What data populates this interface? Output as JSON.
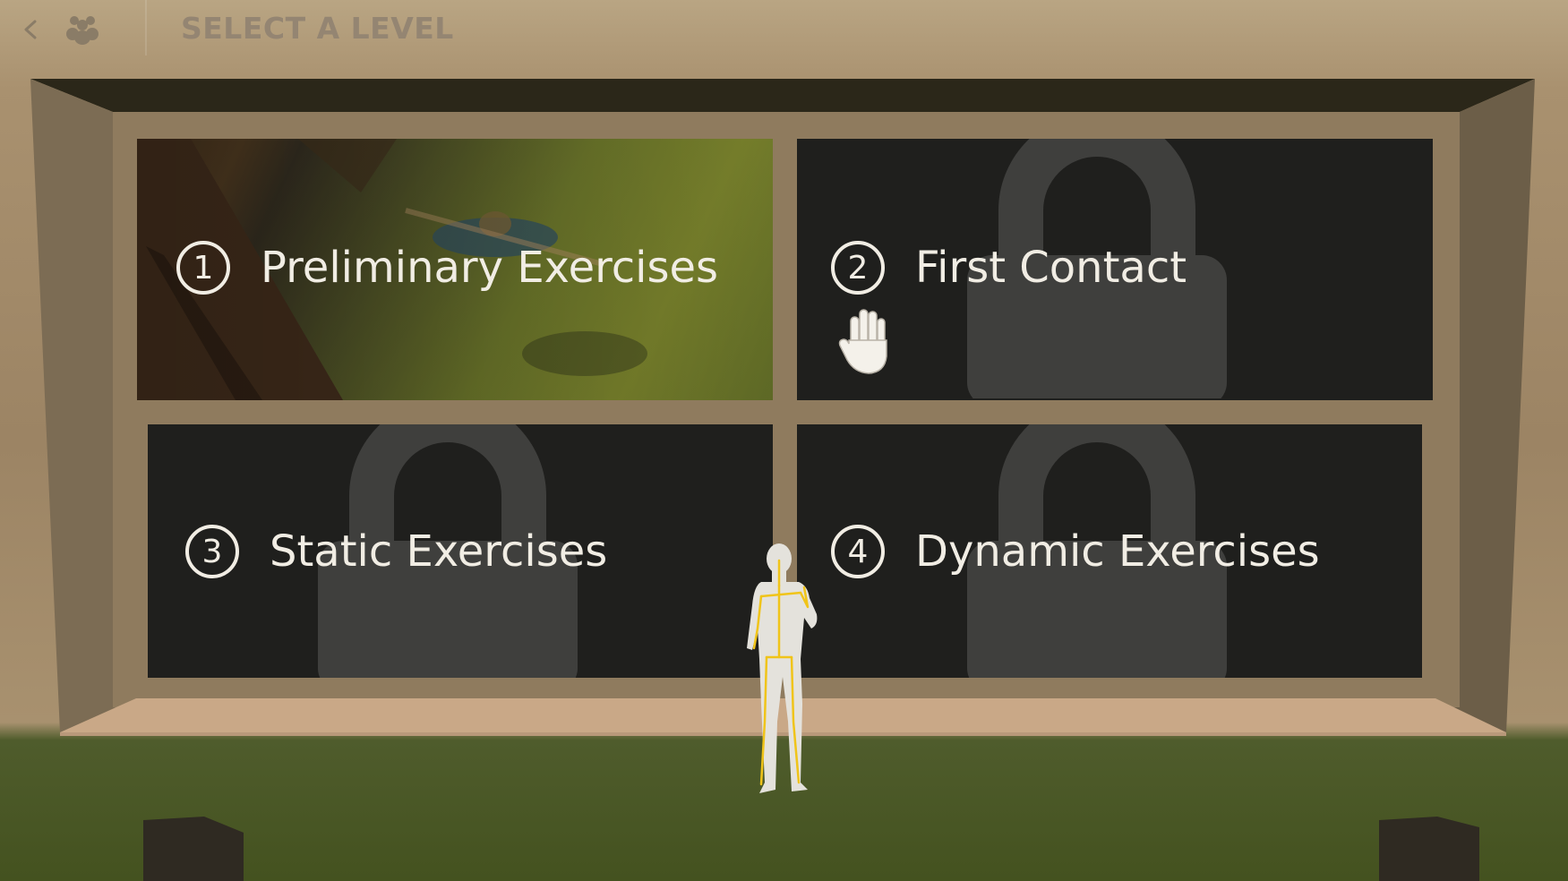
{
  "header": {
    "title": "SELECT A LEVEL",
    "back_icon": "chevron-left-icon",
    "players_icon": "players-group-icon"
  },
  "levels": [
    {
      "number": "1",
      "title": "Preliminary Exercises",
      "locked": false
    },
    {
      "number": "2",
      "title": "First Contact",
      "locked": true
    },
    {
      "number": "3",
      "title": "Static Exercises",
      "locked": true
    },
    {
      "number": "4",
      "title": "Dynamic Exercises",
      "locked": true
    }
  ],
  "cursor": {
    "icon": "hand-cursor-icon"
  },
  "avatar": {
    "icon": "player-skeleton-avatar"
  },
  "colors": {
    "text": "#f1ede4",
    "title": "#948572",
    "frame": "#2f2a20",
    "skeleton": "#f0c419"
  }
}
